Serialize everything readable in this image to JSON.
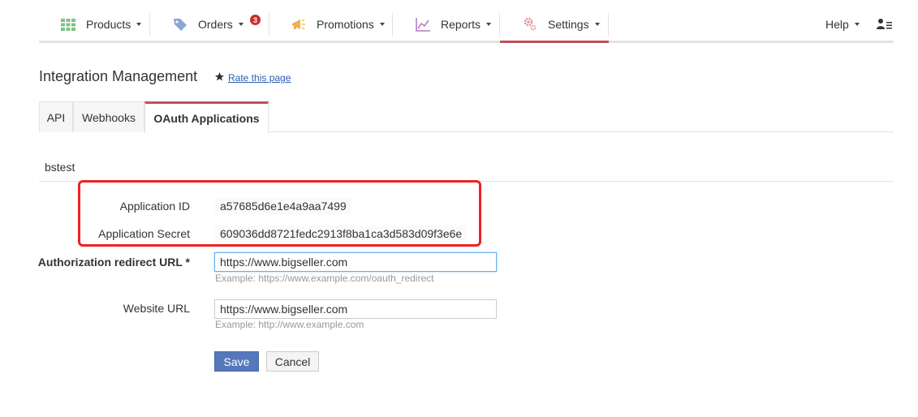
{
  "nav": {
    "items": [
      {
        "label": "Products",
        "icon": "grid-icon"
      },
      {
        "label": "Orders",
        "icon": "tag-icon",
        "badge": "3"
      },
      {
        "label": "Promotions",
        "icon": "megaphone-icon"
      },
      {
        "label": "Reports",
        "icon": "chart-icon"
      },
      {
        "label": "Settings",
        "icon": "gear-icon"
      }
    ],
    "help": "Help",
    "active": "Settings",
    "colors": {
      "accent": "#c0505c",
      "products_icon": "#7dc383",
      "orders_icon": "#8aa7d6",
      "promotions_icon": "#f0b04a",
      "reports_icon": "#b37cc9",
      "settings_icon": "#e38b8b"
    }
  },
  "page": {
    "title": "Integration Management",
    "rate_link": "Rate this page"
  },
  "tabs": [
    "API",
    "Webhooks",
    "OAuth Applications"
  ],
  "active_tab": "OAuth Applications",
  "app": {
    "name": "bstest",
    "application_id_label": "Application ID",
    "application_id": "a57685d6e1e4a9aa7499",
    "application_secret_label": "Application Secret",
    "application_secret": "609036dd8721fedc2913f8ba1ca3d583d09f3e6e",
    "redirect_label": "Authorization redirect URL *",
    "redirect_value": "https://www.bigseller.com",
    "redirect_hint": "Example: https://www.example.com/oauth_redirect",
    "website_label": "Website URL",
    "website_value": "https://www.bigseller.com",
    "website_hint": "Example: http://www.example.com"
  },
  "buttons": {
    "save": "Save",
    "cancel": "Cancel"
  }
}
